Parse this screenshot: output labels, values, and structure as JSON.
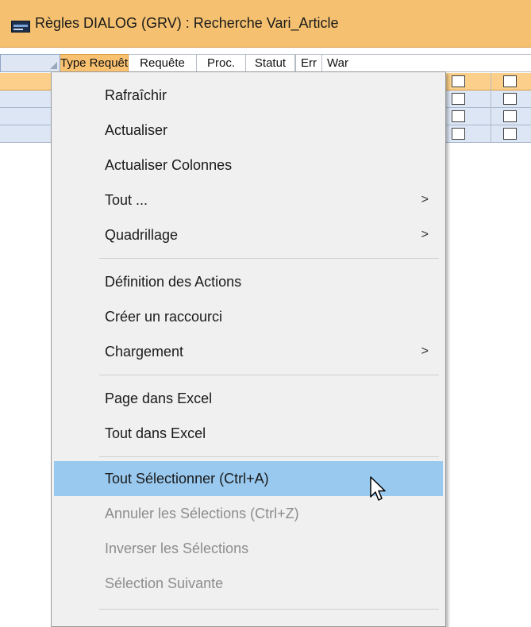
{
  "window": {
    "title": "Règles DIALOG (GRV) : Recherche Vari_Article",
    "icon": "app-window-icon"
  },
  "grid": {
    "columns": [
      "Type Requête",
      "Requête",
      "Proc.",
      "Statut",
      "Err",
      "War"
    ],
    "sorted_column": "Type Requête",
    "rows": [
      {
        "err": false,
        "war": false,
        "current": true
      },
      {
        "err": false,
        "war": false,
        "current": false
      },
      {
        "err": false,
        "war": false,
        "current": false
      },
      {
        "err": false,
        "war": false,
        "current": false
      }
    ]
  },
  "context_menu": {
    "items": [
      {
        "label": "Rafraîchir",
        "submenu": false,
        "enabled": true
      },
      {
        "label": "Actualiser",
        "submenu": false,
        "enabled": true
      },
      {
        "label": "Actualiser Colonnes",
        "submenu": false,
        "enabled": true
      },
      {
        "label": "Tout ...",
        "submenu": true,
        "enabled": true
      },
      {
        "label": "Quadrillage",
        "submenu": true,
        "enabled": true
      },
      {
        "label": "Définition des Actions",
        "submenu": false,
        "enabled": true
      },
      {
        "label": "Créer un raccourci",
        "submenu": false,
        "enabled": true
      },
      {
        "label": "Chargement",
        "submenu": true,
        "enabled": true
      },
      {
        "label": "Page dans Excel",
        "submenu": false,
        "enabled": true
      },
      {
        "label": "Tout dans Excel",
        "submenu": false,
        "enabled": true
      },
      {
        "label": "Tout Sélectionner (Ctrl+A)",
        "submenu": false,
        "enabled": true,
        "highlighted": true
      },
      {
        "label": "Annuler les Sélections (Ctrl+Z)",
        "submenu": false,
        "enabled": false
      },
      {
        "label": "Inverser les Sélections",
        "submenu": false,
        "enabled": false
      },
      {
        "label": "Sélection Suivante",
        "submenu": false,
        "enabled": false
      }
    ],
    "submenu_arrow": ">"
  },
  "colors": {
    "title_bar": "#f5c170",
    "selected_row": "#fcd08a",
    "row": "#dce6f4",
    "menu_background": "#f0f0f0",
    "menu_highlight": "#99c9ef",
    "disabled_text": "#8d8d8d"
  }
}
